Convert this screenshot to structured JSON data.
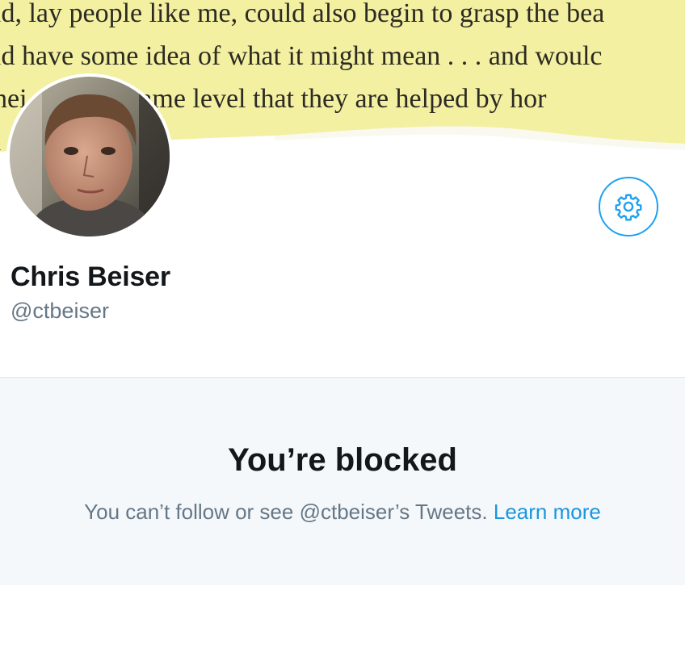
{
  "banner": {
    "lines": [
      "ld, lay people like me, could also begin to grasp the bea",
      "ld have some idea of what it might mean . . . and woulc",
      "hei         the same level that they are helped by hor",
      "l"
    ]
  },
  "profile": {
    "display_name": "Chris Beiser",
    "handle": "@ctbeiser"
  },
  "settings": {
    "icon": "gear-icon",
    "accent_color": "#1da1f2"
  },
  "blocked": {
    "title": "You’re blocked",
    "message": "You can’t follow or see @ctbeiser’s Tweets.",
    "learn_more_label": "Learn more",
    "link_color": "#1b95e0"
  }
}
